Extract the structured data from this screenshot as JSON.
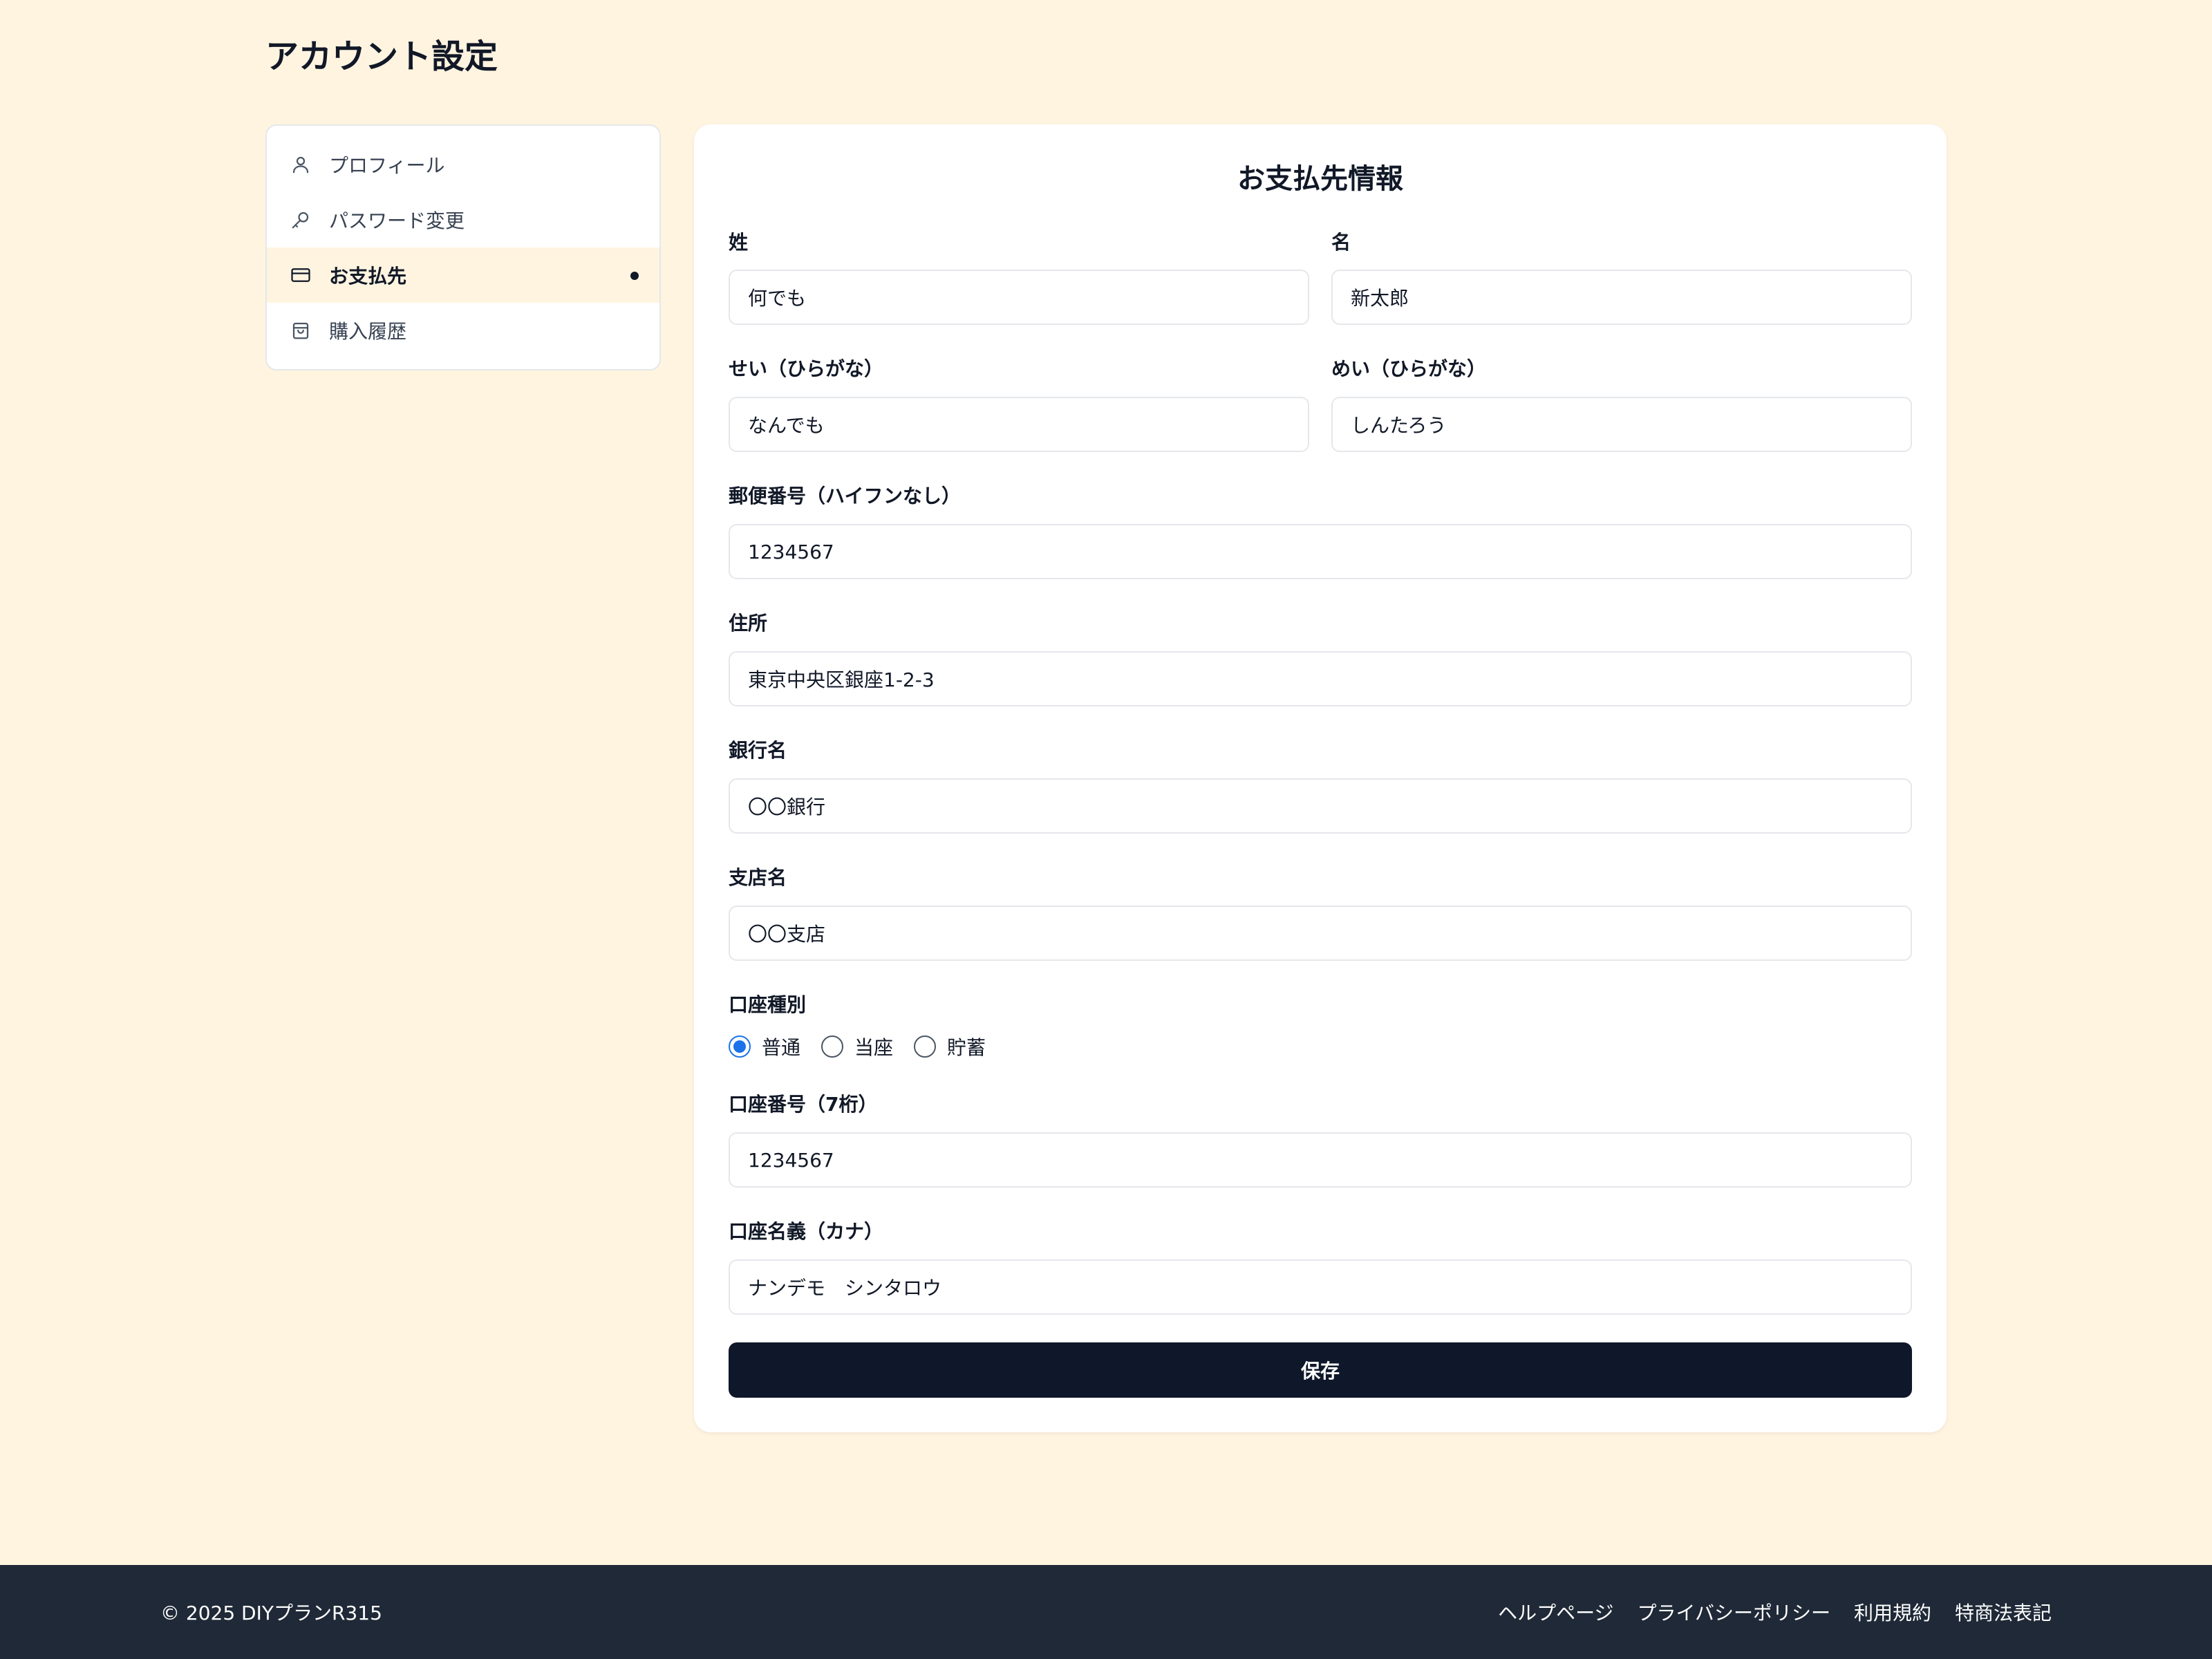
{
  "page": {
    "title": "アカウント設定"
  },
  "sidebar": {
    "items": [
      {
        "label": "プロフィール",
        "icon": "user-icon"
      },
      {
        "label": "パスワード変更",
        "icon": "key-icon"
      },
      {
        "label": "お支払先",
        "icon": "credit-card-icon",
        "active": true
      },
      {
        "label": "購入履歴",
        "icon": "shopping-bag-icon"
      }
    ]
  },
  "form": {
    "title": "お支払先情報",
    "last_name": {
      "label": "姓",
      "value": "何でも"
    },
    "first_name": {
      "label": "名",
      "value": "新太郎"
    },
    "last_name_kana": {
      "label": "せい（ひらがな）",
      "value": "なんでも"
    },
    "first_name_kana": {
      "label": "めい（ひらがな）",
      "value": "しんたろう"
    },
    "postal_code": {
      "label": "郵便番号（ハイフンなし）",
      "value": "1234567"
    },
    "address": {
      "label": "住所",
      "value": "東京中央区銀座1-2-3"
    },
    "bank_name": {
      "label": "銀行名",
      "value": "〇〇銀行"
    },
    "branch_name": {
      "label": "支店名",
      "value": "〇〇支店"
    },
    "account_type": {
      "label": "口座種別",
      "options": [
        "普通",
        "当座",
        "貯蓄"
      ],
      "selected": "普通"
    },
    "account_number": {
      "label": "口座番号（7桁）",
      "value": "1234567"
    },
    "account_holder": {
      "label": "口座名義（カナ）",
      "value": "ナンデモ　シンタロウ"
    },
    "save_label": "保存"
  },
  "footer": {
    "copyright": "© 2025 DIYプランR315",
    "links": [
      "ヘルプページ",
      "プライバシーポリシー",
      "利用規約",
      "特商法表記"
    ]
  },
  "colors": {
    "background": "#fff4e0",
    "primary_button": "#0f172a",
    "footer": "#1f2937",
    "radio_accent": "#1a73e8"
  }
}
